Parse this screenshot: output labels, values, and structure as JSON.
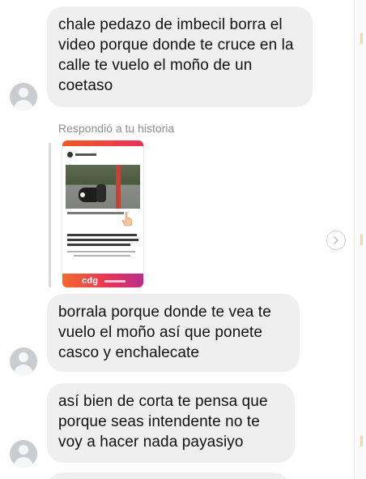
{
  "conversation": {
    "messages": [
      {
        "text": "chale pedazo de imbecil borra el video porque donde te cruce en la calle te vuelo el moño de un coetaso"
      },
      {
        "text": "borrala porque donde te vea te vuelo el moño así que ponete casco y enchalecate"
      },
      {
        "text": "así bien de corta te pensa que porque seas intendente no te voy a hacer nada payasiyo"
      }
    ],
    "story_reply": {
      "label": "Respondió a tu historia",
      "logo": "cdg"
    }
  },
  "icons": {
    "avatar": "default-user-avatar-icon",
    "chevron": "chevron-right-icon",
    "pointer": "pointing-hand-icon"
  },
  "colors": {
    "bubble_bg": "#efefef",
    "muted_text": "#8e8e8e",
    "story_gradient_start": "#f15a24",
    "story_gradient_end": "#e8315b"
  }
}
